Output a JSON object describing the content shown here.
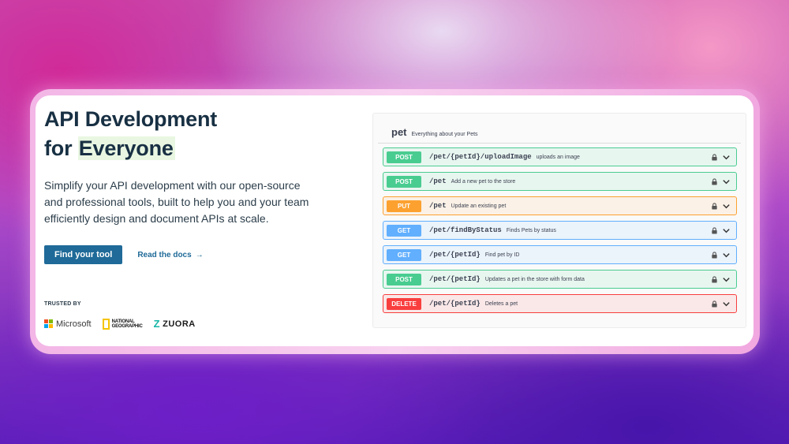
{
  "hero": {
    "headline_line1": "API Development",
    "headline_word_for": "for",
    "headline_highlight": "Everyone",
    "subtext": "Simplify your API development with our open-source and professional tools, built to help you and your team efficiently design and document APIs at scale.",
    "primary_cta": "Find your tool",
    "secondary_cta": "Read the docs",
    "secondary_cta_arrow": "→",
    "trusted_by": "TRUSTED BY",
    "logos": {
      "microsoft": "Microsoft",
      "natgeo_line1": "NATIONAL",
      "natgeo_line2": "GEOGRAPHIC",
      "zuora": "ZUORA",
      "zuora_mark": "Z"
    }
  },
  "api_panel": {
    "tag": "pet",
    "tag_description": "Everything about your Pets",
    "operations": [
      {
        "method": "POST",
        "path": "/pet/{petId}/uploadImage",
        "summary": "uploads an image"
      },
      {
        "method": "POST",
        "path": "/pet",
        "summary": "Add a new pet to the store"
      },
      {
        "method": "PUT",
        "path": "/pet",
        "summary": "Update an existing pet"
      },
      {
        "method": "GET",
        "path": "/pet/findByStatus",
        "summary": "Finds Pets by status"
      },
      {
        "method": "GET",
        "path": "/pet/{petId}",
        "summary": "Find pet by ID"
      },
      {
        "method": "POST",
        "path": "/pet/{petId}",
        "summary": "Updates a pet in the store with form data"
      },
      {
        "method": "DELETE",
        "path": "/pet/{petId}",
        "summary": "Deletes a pet"
      }
    ]
  },
  "colors": {
    "post": "#49cc90",
    "put": "#fca130",
    "get": "#61affe",
    "delete": "#f93e3e",
    "primary_button": "#1f6a98",
    "headline": "#183043"
  }
}
